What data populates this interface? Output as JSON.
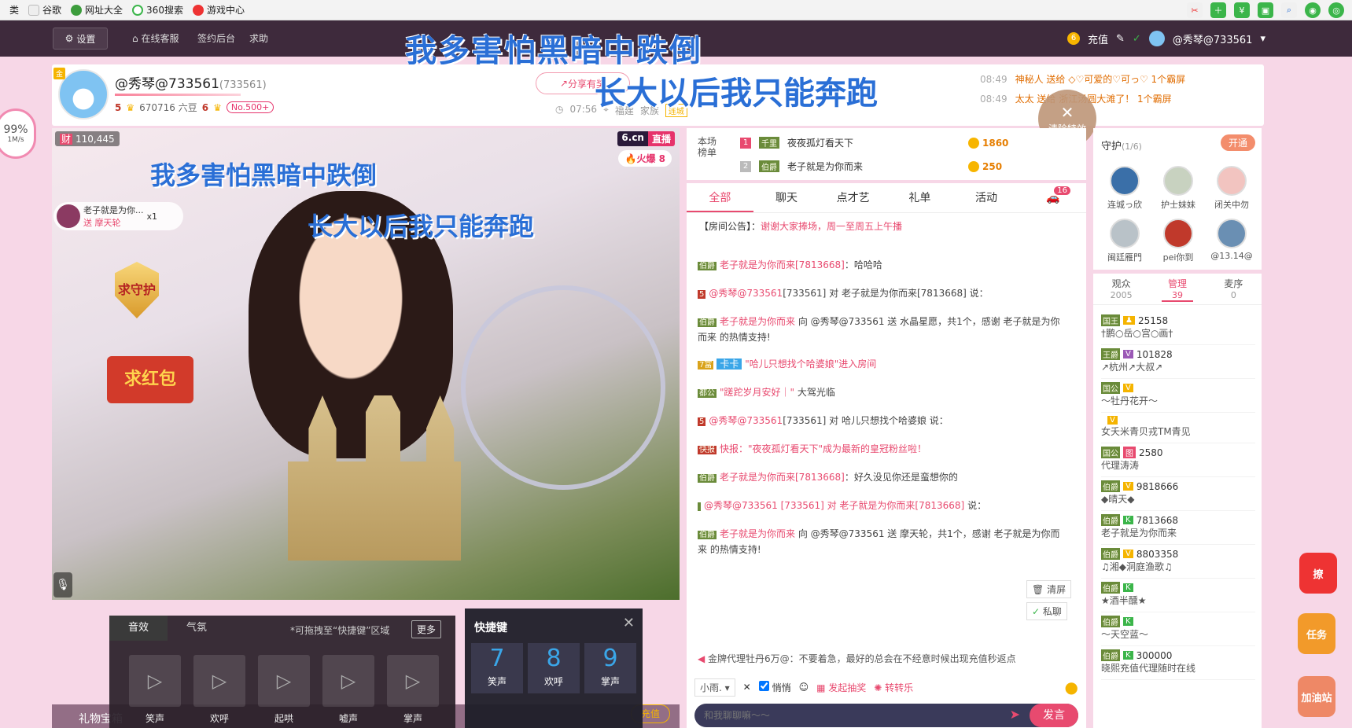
{
  "bookmarks": [
    "类",
    "谷歌",
    "网址大全",
    "360搜索",
    "游戏中心"
  ],
  "header": {
    "settings_label": "设置",
    "nav": [
      "在线客服",
      "签约后台",
      "求助"
    ],
    "overlay_title": "我多害怕黑暗中跌倒",
    "recharge_label": "充值",
    "username": "@秀琴@733561"
  },
  "streamer": {
    "vip_tag": "金",
    "name": "@秀琴@733561",
    "room_id": "(733561)",
    "level": "5",
    "beans": "670716 六豆",
    "fans_level": "6",
    "rank": "No.500+",
    "share_label": "分享有奖",
    "time": "07:56",
    "location": "福建",
    "family_label": "家族",
    "fan_tag": "连城",
    "overlay_title2": "长大以后我只能奔跑"
  },
  "notices": [
    {
      "time": "08:49",
      "text": "神秘人 送给 ◇♡可爱的♡可っ♡ 1个霸屏"
    },
    {
      "time": "08:49",
      "text": "太太 送给 浙江汤圆大滩了！ 1个霸屏"
    }
  ],
  "clear_effects_label": "清除特效",
  "speed": {
    "percent": "99%",
    "rate": "1M/s"
  },
  "video": {
    "wealth": "110,445",
    "wealth_tag": "财",
    "live_brand": "6.cn",
    "live_label": "直播",
    "hot_label": "火爆",
    "hot_count": "8",
    "title1": "我多害怕黑暗中跌倒",
    "title2": "长大以后我只能奔跑",
    "gift_user": "老子就是为你...",
    "gift_send": "送 摩天轮",
    "gift_count": "x1",
    "guard_text": "求守护",
    "redpack_text": "求红包",
    "mic_icon": "mic-icon"
  },
  "sfx": {
    "tabs": [
      "音效",
      "气氛"
    ],
    "hint": "*可拖拽至“快捷键”区域",
    "more_label": "更多",
    "items": [
      "笑声",
      "欢呼",
      "起哄",
      "嘘声",
      "掌声"
    ]
  },
  "hotkeys": {
    "title": "快捷键",
    "items": [
      {
        "num": "7",
        "label": "笑声"
      },
      {
        "num": "8",
        "label": "欢呼"
      },
      {
        "num": "9",
        "label": "掌声"
      }
    ]
  },
  "bottom": {
    "gift_box": "礼物宝箱",
    "recharge": "充值"
  },
  "ranking": {
    "label": "本场榜单",
    "rows": [
      {
        "idx": "1",
        "badge": "千里",
        "name": "夜夜孤灯看天下",
        "score": "1860"
      },
      {
        "idx": "2",
        "badge": "伯爵",
        "name": "老子就是为你而来",
        "score": "250"
      }
    ]
  },
  "chat": {
    "tabs": [
      "全部",
      "聊天",
      "点才艺",
      "礼单",
      "活动"
    ],
    "car_count": "16",
    "announce_prefix": "【房间公告】：",
    "announce_text": "谢谢大家捧场，周一至周五上午播",
    "messages": [
      {
        "badge": "伯爵",
        "user": "老子就是为你而来[7813668]",
        "text": "：哈哈哈"
      },
      {
        "badge": "5",
        "user": "@秀琴@733561",
        "text": "[733561] 对 老子就是为你而来[7813668] 说："
      },
      {
        "badge": "伯爵",
        "user": "老子就是为你而来",
        "text": "向 @秀琴@733561 送 水晶星愿，共1个，感谢 老子就是为你而来 的热情支持!"
      },
      {
        "badge": "7富",
        "user": "卡卡",
        "text": "\"哈儿只想找个哈婆娘\"进入房间"
      },
      {
        "badge": "都公",
        "user": "\"蹉跎岁月安好｜\"",
        "text": "大驾光临"
      },
      {
        "badge": "5",
        "user": "@秀琴@733561",
        "text": "[733561] 对 哈儿只想找个哈婆娘 说："
      },
      {
        "badge": "快报",
        "user": "快报：\"夜夜孤灯看天下\"成为最新的皇冠粉丝啦！",
        "text": ""
      },
      {
        "badge": "伯爵",
        "user": "老子就是为你而来[7813668]",
        "text": "：好久没见你还是蛮想你的"
      },
      {
        "badge": "",
        "user": "@秀琴@733561 [733561] 对 老子就是为你而来[7813668]",
        "text": "说："
      },
      {
        "badge": "伯爵",
        "user": "老子就是为你而来",
        "text": "向 @秀琴@733561 送 摩天轮，共1个，感谢 老子就是为你而来 的热情支持!"
      }
    ],
    "clear_label": "清屏",
    "private_label": "私聊",
    "system_msg": "金牌代理牡丹6万@：不要着急，最好的总会在不经意时候出现充值秒返点",
    "target": "小雨.",
    "whisper_label": "悄悄",
    "launch_label": "发起抽奖",
    "spin_label": "转转乐",
    "input_placeholder": "和我聊聊嘛～～",
    "send_label": "发言"
  },
  "guards": {
    "title": "守护",
    "count": "(1/6)",
    "open_label": "开通",
    "list": [
      "连城っ欣",
      "护士妹妹",
      "闭关中勿",
      "闽廷雁門",
      "pei你到",
      "@13.14@"
    ]
  },
  "audience": {
    "tabs": [
      {
        "label": "观众",
        "count": "2005"
      },
      {
        "label": "管理",
        "count": "39"
      },
      {
        "label": "麦序",
        "count": "0"
      }
    ],
    "list": [
      {
        "badge": "国王",
        "num": "25158",
        "name": "†鹏○岳○宫○画†"
      },
      {
        "badge": "王爵",
        "num": "101828",
        "name": "↗杭州↗大叔↗"
      },
      {
        "badge": "国公",
        "num": "",
        "name": "～牡丹花开～"
      },
      {
        "badge": "",
        "num": "",
        "name": "女夭米青贝戎TM青见"
      },
      {
        "badge": "国公",
        "num": "2580",
        "name": "代理涛涛"
      },
      {
        "badge": "伯爵",
        "num": "9818666",
        "name": "◆晴天◆"
      },
      {
        "badge": "伯爵",
        "num": "7813668",
        "name": "老子就是为你而来"
      },
      {
        "badge": "伯爵",
        "num": "8803358",
        "name": "♫湘◆洞庭渔歌♫"
      },
      {
        "badge": "伯爵",
        "num": "",
        "name": "★酒半醺★"
      },
      {
        "badge": "伯爵",
        "num": "",
        "name": "～天空蓝～"
      },
      {
        "badge": "伯爵",
        "num": "300000",
        "name": "晓熙充值代理随时在线"
      }
    ]
  },
  "floating": {
    "liao": "撩",
    "task": "任务",
    "jiayou": "加油站"
  },
  "colors": {
    "accent": "#e84a6f",
    "header_bg": "#3e2a3c",
    "page_bg": "#f7d7e7",
    "title_blue": "#2a6fd6"
  }
}
